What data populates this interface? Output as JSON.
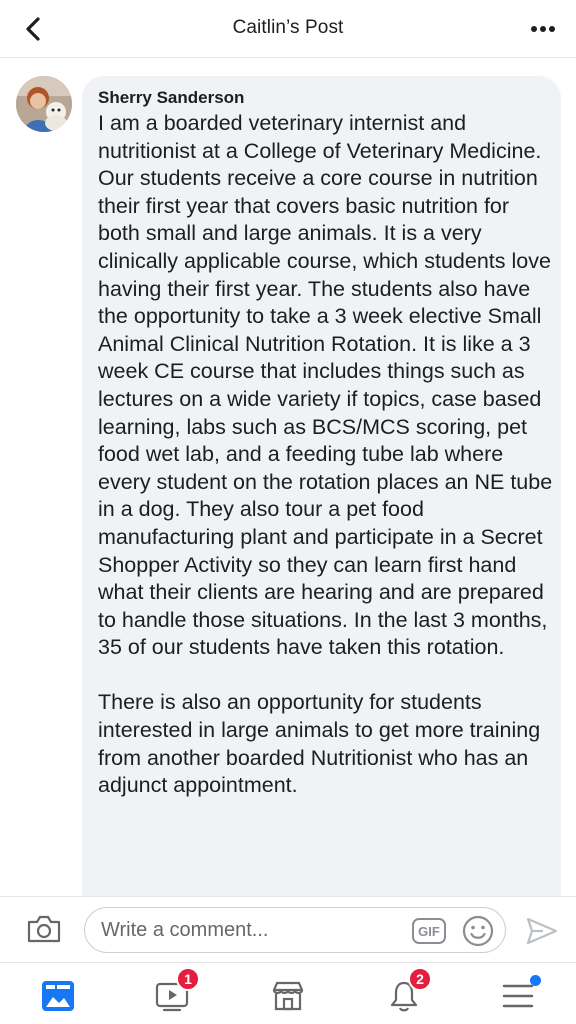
{
  "header": {
    "title": "Caitlin’s Post",
    "back_icon": "chevron-left-icon",
    "more_icon": "more-horizontal-icon"
  },
  "comment": {
    "author": "Sherry Sanderson",
    "paragraph1": "I am a boarded veterinary internist and nutritionist at a College of Veterinary Medicine. Our students receive a core course in nutrition their first year that covers basic nutrition for both small and large animals. It is a very clinically applicable course, which students love having their first year. The students also have the opportunity to take a 3 week elective Small Animal Clinical Nutrition Rotation. It is like a 3 week CE course that includes things such as  lectures on a wide variety if topics, case based learning, labs such as BCS/MCS scoring, pet food wet lab, and a feeding tube lab where every student on the rotation places an NE tube in a dog. They also tour a pet food manufacturing plant and participate in a Secret Shopper Activity so they can learn first hand what their clients are hearing and are prepared to handle those situations. In the last 3 months, 35 of our students have taken this rotation.",
    "paragraph2": "There is also an opportunity for students interested in large animals to get more training from another boarded Nutritionist who has an adjunct appointment."
  },
  "composer": {
    "placeholder": "Write a comment...",
    "gif_label": "GIF"
  },
  "tabbar": {
    "video_badge": "1",
    "notifications_badge": "2"
  },
  "colors": {
    "accent": "#1877f2",
    "badge": "#e41e3f",
    "bubble": "#f0f2f5"
  }
}
